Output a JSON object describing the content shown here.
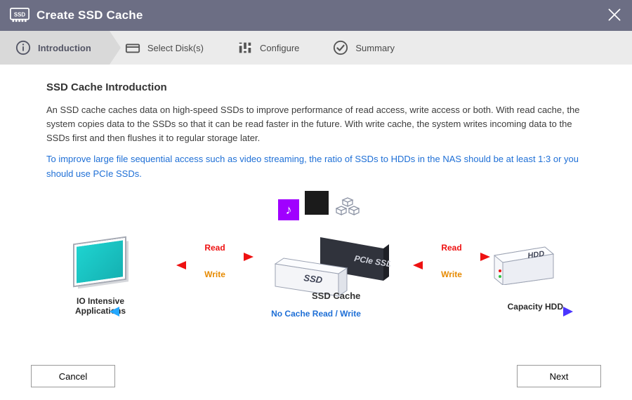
{
  "header": {
    "title": "Create SSD Cache"
  },
  "steps": [
    {
      "label": "Introduction",
      "icon": "info"
    },
    {
      "label": "Select Disk(s)",
      "icon": "disk"
    },
    {
      "label": "Configure",
      "icon": "sliders"
    },
    {
      "label": "Summary",
      "icon": "check"
    }
  ],
  "active_step": 0,
  "content": {
    "heading": "SSD Cache Introduction",
    "paragraph": "An SSD cache caches data on high-speed SSDs to improve performance of read access, write access or both. With read cache, the system copies data to the SSDs so that it can be read faster in the future. With write cache, the system writes incoming data to the SSDs first and then flushes it to regular storage later.",
    "note": "To improve large file sequential access such as video streaming, the ratio of SSDs to HDDs in the NAS should be at least 1:3 or you should use PCIe SSDs."
  },
  "diagram": {
    "left_label": "IO Intensive Applications",
    "center_label": "SSD Cache",
    "right_label": "Capacity HDD",
    "read_label": "Read",
    "write_label": "Write",
    "bottom_label": "No Cache Read / Write",
    "ssd_text1": "SSD",
    "ssd_text2": "PCIe SSD",
    "hdd_text": "HDD"
  },
  "buttons": {
    "cancel": "Cancel",
    "next": "Next"
  }
}
